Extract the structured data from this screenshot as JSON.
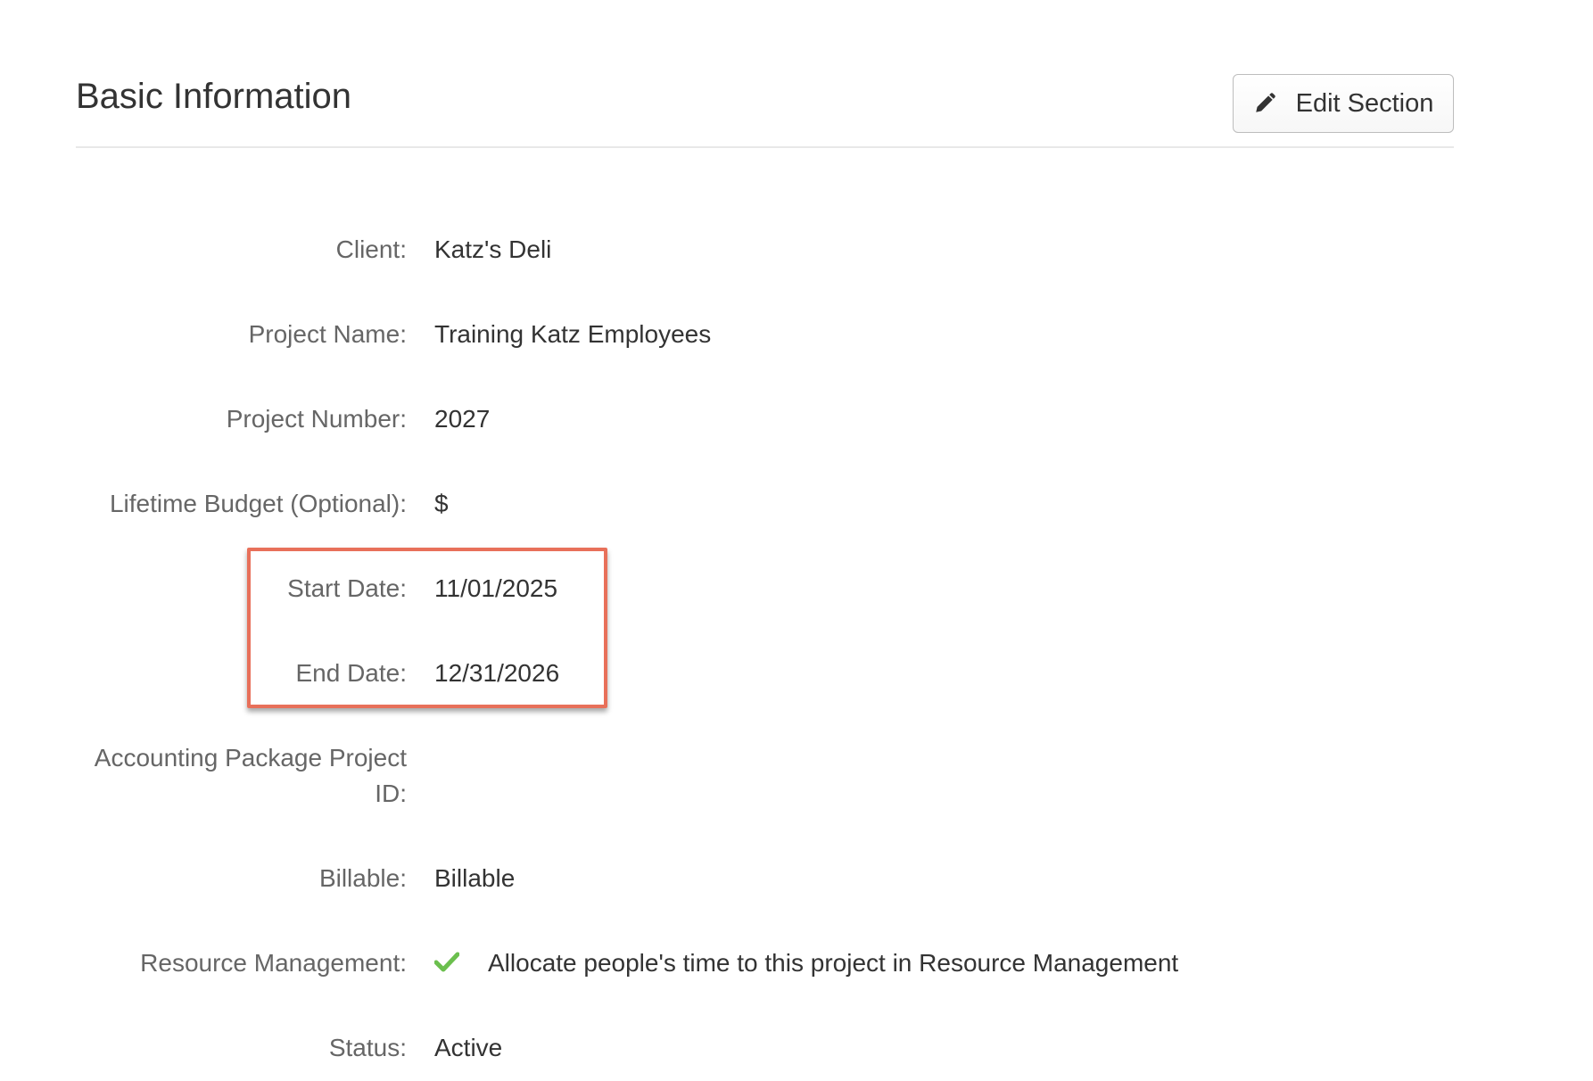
{
  "section": {
    "title": "Basic Information",
    "edit_button_label": "Edit Section"
  },
  "fields": {
    "client": {
      "label": "Client:",
      "value": "Katz's Deli"
    },
    "project_name": {
      "label": "Project Name:",
      "value": "Training Katz Employees"
    },
    "project_number": {
      "label": "Project Number:",
      "value": "2027"
    },
    "lifetime_budget": {
      "label": "Lifetime Budget (Optional):",
      "value": "$"
    },
    "start_date": {
      "label": "Start Date:",
      "value": "11/01/2025"
    },
    "end_date": {
      "label": "End Date:",
      "value": "12/31/2026"
    },
    "accounting_id": {
      "label_line1": "Accounting Package Project",
      "label_line2": "ID:",
      "value": ""
    },
    "billable": {
      "label": "Billable:",
      "value": "Billable"
    },
    "resource_management": {
      "label": "Resource Management:",
      "icon": "check-icon",
      "value": "Allocate people's time to this project in Resource Management"
    },
    "status": {
      "label": "Status:",
      "value": "Active"
    }
  },
  "colors": {
    "highlight_border": "#e8705a",
    "check_green": "#6bbf4e",
    "label_gray": "#666666",
    "value_dark": "#333333"
  }
}
